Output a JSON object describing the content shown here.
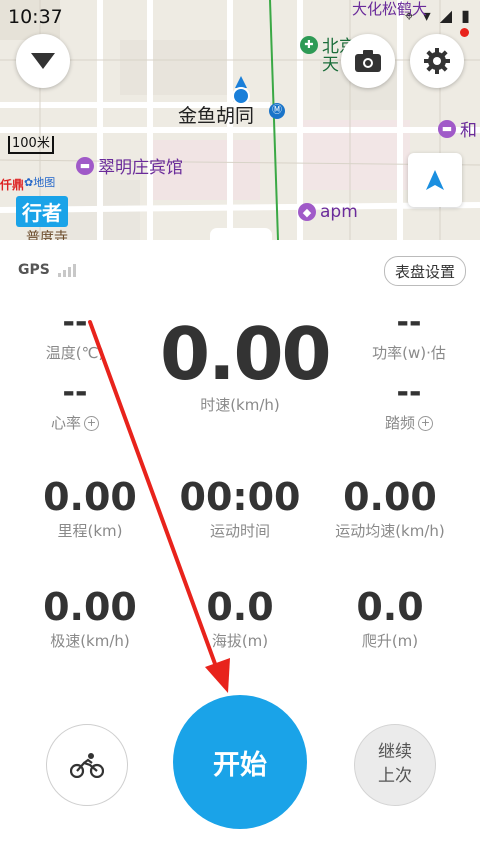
{
  "status": {
    "time": "10:37",
    "icons": "⌖ ▾ ◢ ▮"
  },
  "map": {
    "labels": {
      "jinyu": "金鱼胡同",
      "cuiming": "翠明庄宾馆",
      "apm": "apm",
      "beijing": "北京",
      "wangfujing": "天",
      "dayuan": "大化松鹤大",
      "right1": "和",
      "left_red": "仟鼎",
      "baidu": "地图",
      "bottom_left": "普度寺"
    },
    "scale": "100米",
    "xingzhe": "行者"
  },
  "panel": {
    "gps_label": "GPS",
    "dashboard_button": "表盘设置",
    "metrics": {
      "temperature": {
        "value": "--",
        "label": "温度(℃)"
      },
      "power": {
        "value": "--",
        "label": "功率(w)·估"
      },
      "speed": {
        "value": "0.00",
        "label": "时速(km/h)"
      },
      "heart": {
        "value": "--",
        "label": "心率"
      },
      "cadence": {
        "value": "--",
        "label": "踏频"
      },
      "distance": {
        "value": "0.00",
        "label": "里程(km)"
      },
      "duration": {
        "value": "00:00",
        "label": "运动时间"
      },
      "avg_speed": {
        "value": "0.00",
        "label": "运动均速(km/h)"
      },
      "max_speed": {
        "value": "0.00",
        "label": "极速(km/h)"
      },
      "altitude": {
        "value": "0.0",
        "label": "海拔(m)"
      },
      "climb": {
        "value": "0.0",
        "label": "爬升(m)"
      }
    },
    "plus_symbol": "+",
    "start_button": "开始",
    "resume_button_line1": "继续",
    "resume_button_line2": "上次"
  },
  "colors": {
    "accent": "#1aa3e8",
    "arrow": "#e8231c",
    "metric_text": "#333333"
  }
}
